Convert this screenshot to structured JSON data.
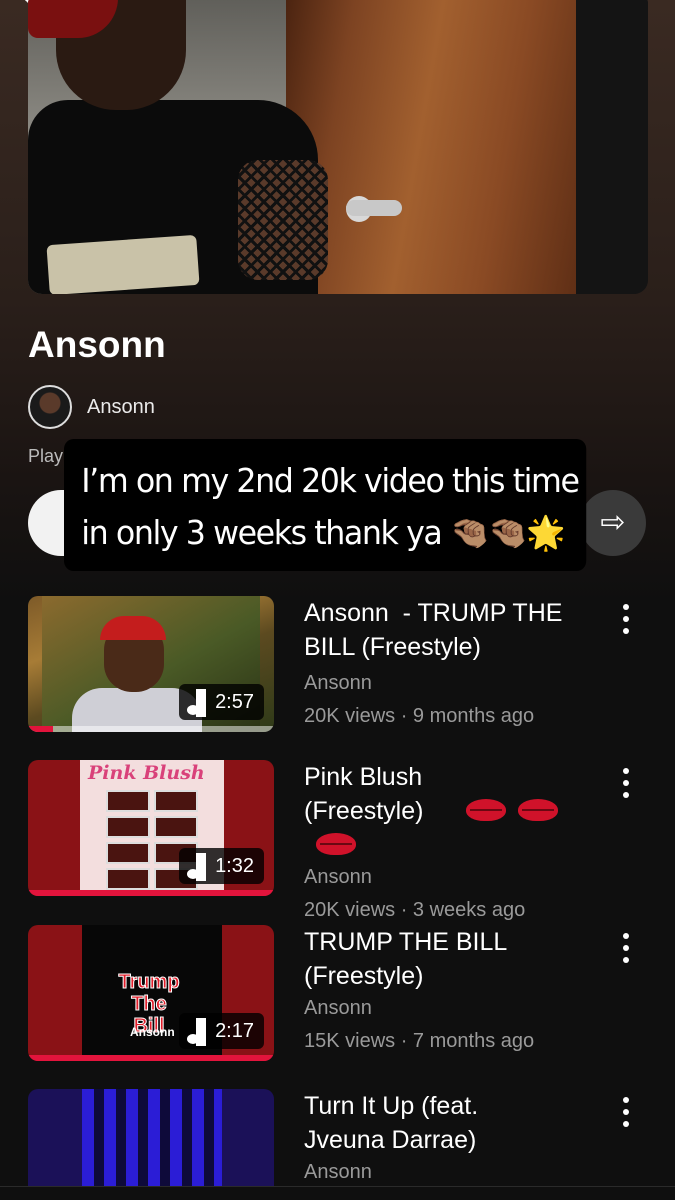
{
  "playlist": {
    "title": "Ansonn",
    "owner": "Ansonn",
    "meta_partial": "Play"
  },
  "overlay": {
    "line1": "I’m on my 2nd 20k video this time",
    "line2": "in only 3 weeks thank ya 🤏🏽🤏🏽🌟"
  },
  "videos": [
    {
      "title": "Ansonn  - TRUMP THE BILL (Freestyle)",
      "channel": "Ansonn",
      "meta": "20K views · 9 months ago",
      "duration": "2:57",
      "watched_fraction": 0.1
    },
    {
      "title": "Pink Blush (Freestyle)",
      "channel": "Ansonn",
      "meta": "20K views · 3 weeks ago",
      "duration": "1:32",
      "watched_fraction": 1.0,
      "thumb_text": "Pink Blush"
    },
    {
      "title": "TRUMP THE BILL (Freestyle)",
      "channel": "Ansonn",
      "meta": "15K views · 7 months ago",
      "duration": "2:17",
      "watched_fraction": 1.0,
      "thumb_text": "Trump The Bill",
      "thumb_subtext": "Ansonn"
    },
    {
      "title": "Turn It Up (feat. Jveuna Darrae)",
      "channel": "Ansonn"
    }
  ],
  "colors": {
    "accent": "#e3143c",
    "background": "#0f0f0f"
  }
}
